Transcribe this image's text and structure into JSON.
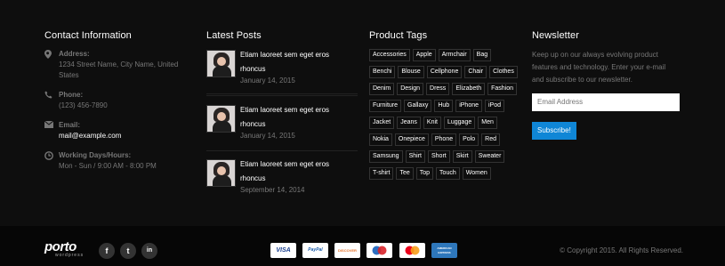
{
  "contact": {
    "heading": "Contact Information",
    "items": [
      {
        "icon": "map-marker-icon",
        "label": "Address:",
        "lines": [
          "1234 Street Name, City Name, United",
          "States"
        ]
      },
      {
        "icon": "phone-icon",
        "label": "Phone:",
        "lines": [
          "(123) 456-7890"
        ]
      },
      {
        "icon": "envelope-icon",
        "label": "Email:",
        "lines": [
          "mail@example.com"
        ]
      },
      {
        "icon": "clock-icon",
        "label": "Working Days/Hours:",
        "lines": [
          "Mon - Sun / 9:00 AM - 8:00 PM"
        ]
      }
    ]
  },
  "posts": {
    "heading": "Latest Posts",
    "items": [
      {
        "title_line1": "Etiam laoreet sem eget eros",
        "title_line2": "rhoncus",
        "date": "January 14, 2015"
      },
      {
        "title_line1": "Etiam laoreet sem eget eros",
        "title_line2": "rhoncus",
        "date": "January 14, 2015"
      },
      {
        "title_line1": "Etiam laoreet sem eget eros",
        "title_line2": "rhoncus",
        "date": "September 14, 2014"
      }
    ]
  },
  "tags": {
    "heading": "Product Tags",
    "items": [
      "Accessories",
      "Apple",
      "Armchair",
      "Bag",
      "Benchi",
      "Blouse",
      "Cellphone",
      "Chair",
      "Clothes",
      "Denim",
      "Design",
      "Dress",
      "Elizabeth",
      "Fashion",
      "Furniture",
      "Gallaxy",
      "Hub",
      "iPhone",
      "iPod",
      "Jacket",
      "Jeans",
      "Knit",
      "Luggage",
      "Men",
      "Nokia",
      "Onepiece",
      "Phone",
      "Polo",
      "Red",
      "Samsung",
      "Shirt",
      "Short",
      "Skirt",
      "Sweater",
      "T-shirt",
      "Tee",
      "Top",
      "Touch",
      "Women"
    ]
  },
  "newsletter": {
    "heading": "Newsletter",
    "text_lines": [
      "Keep up on our always evolving product",
      "features and technology. Enter your e-mail",
      "and subscribe to our newsletter."
    ],
    "placeholder": "Email Address",
    "button": "Subscribe!"
  },
  "bottom": {
    "logo_main": "porto",
    "logo_sub": "wordpress",
    "social": [
      {
        "icon": "facebook-icon",
        "glyph": "f"
      },
      {
        "icon": "twitter-icon",
        "glyph": "t"
      },
      {
        "icon": "linkedin-icon",
        "glyph": "in"
      }
    ],
    "payments": [
      {
        "icon": "visa-card-icon",
        "text": "VISA",
        "color": "#1a3f8f"
      },
      {
        "icon": "paypal-card-icon",
        "text": "PayPal",
        "color": "#1b5dab"
      },
      {
        "icon": "discover-card-icon",
        "text": "DISCOVER",
        "color": "#e6722a"
      },
      {
        "icon": "maestro-card-icon",
        "text": "",
        "color": "#d8232a"
      },
      {
        "icon": "mastercard-icon",
        "text": "",
        "color": "#eb001b"
      },
      {
        "icon": "amex-card-icon",
        "text": "AMERICAN EXPRESS",
        "color": "#2e77bb"
      }
    ],
    "copyright": "© Copyright 2015. All Rights Reserved."
  },
  "colors": {
    "accent": "#0f86d6",
    "background": "#0e0e0e",
    "bottom_bar": "#060606"
  }
}
